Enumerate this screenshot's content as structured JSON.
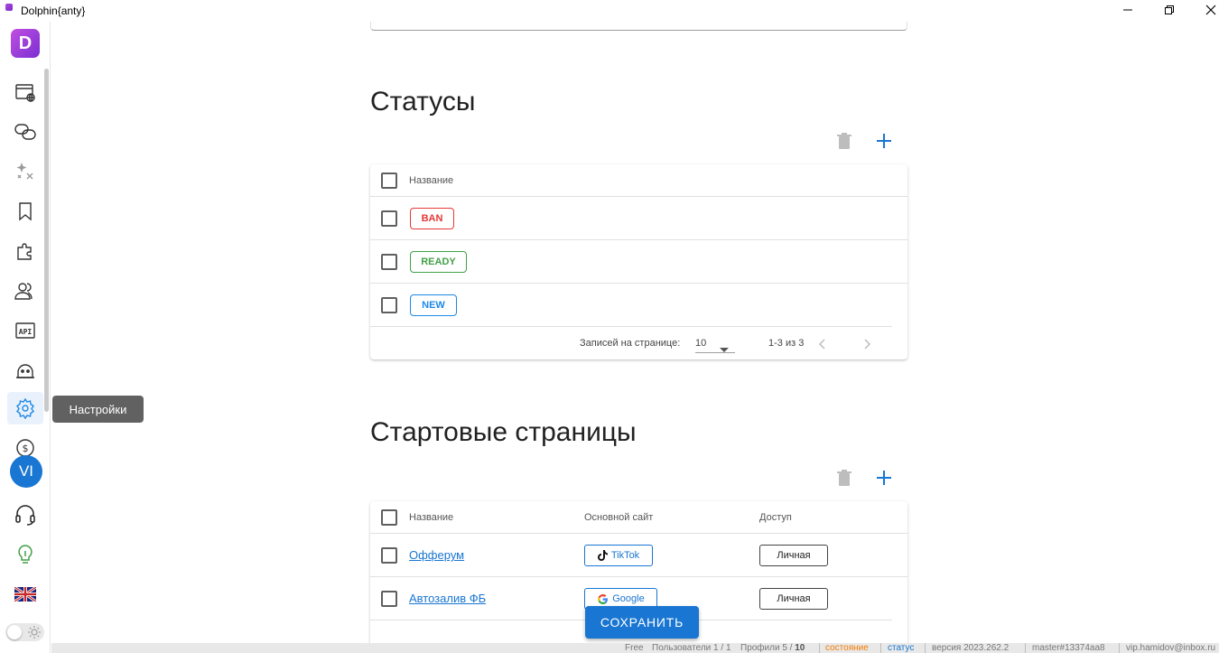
{
  "window": {
    "title": "Dolphin{anty}"
  },
  "sidebar": {
    "logo_letter": "D",
    "avatar_initials": "VI",
    "tooltip": "Настройки"
  },
  "statuses": {
    "title": "Статусы",
    "header_name": "Название",
    "rows": [
      {
        "label": "BAN",
        "color": "#e53935"
      },
      {
        "label": "READY",
        "color": "#43a047"
      },
      {
        "label": "NEW",
        "color": "#1e88e5"
      }
    ],
    "footer": {
      "rows_per_page_label": "Записей на странице:",
      "rows_per_page_value": "10",
      "range": "1-3 из 3"
    }
  },
  "start_pages": {
    "title": "Стартовые страницы",
    "header_name": "Название",
    "header_site": "Основной сайт",
    "header_access": "Доступ",
    "rows": [
      {
        "name": "Офферум",
        "site": "TikTok",
        "access": "Личная"
      },
      {
        "name": "Автозалив ФБ",
        "site": "Google",
        "access": "Личная"
      }
    ]
  },
  "save_button": "СОХРАНИТЬ",
  "statusbar": {
    "plan": "Free",
    "users": "Пользователи 1 / 1",
    "profiles_label": "Профили 5 /",
    "profiles_limit": "10",
    "state": "состояние",
    "status": "статус",
    "version": "версия 2023.262.2",
    "build": "master#13374aa8",
    "email": "vip.hamidov@inbox.ru"
  },
  "colors": {
    "accent": "#1976d2",
    "state_orange": "#f57c00"
  }
}
